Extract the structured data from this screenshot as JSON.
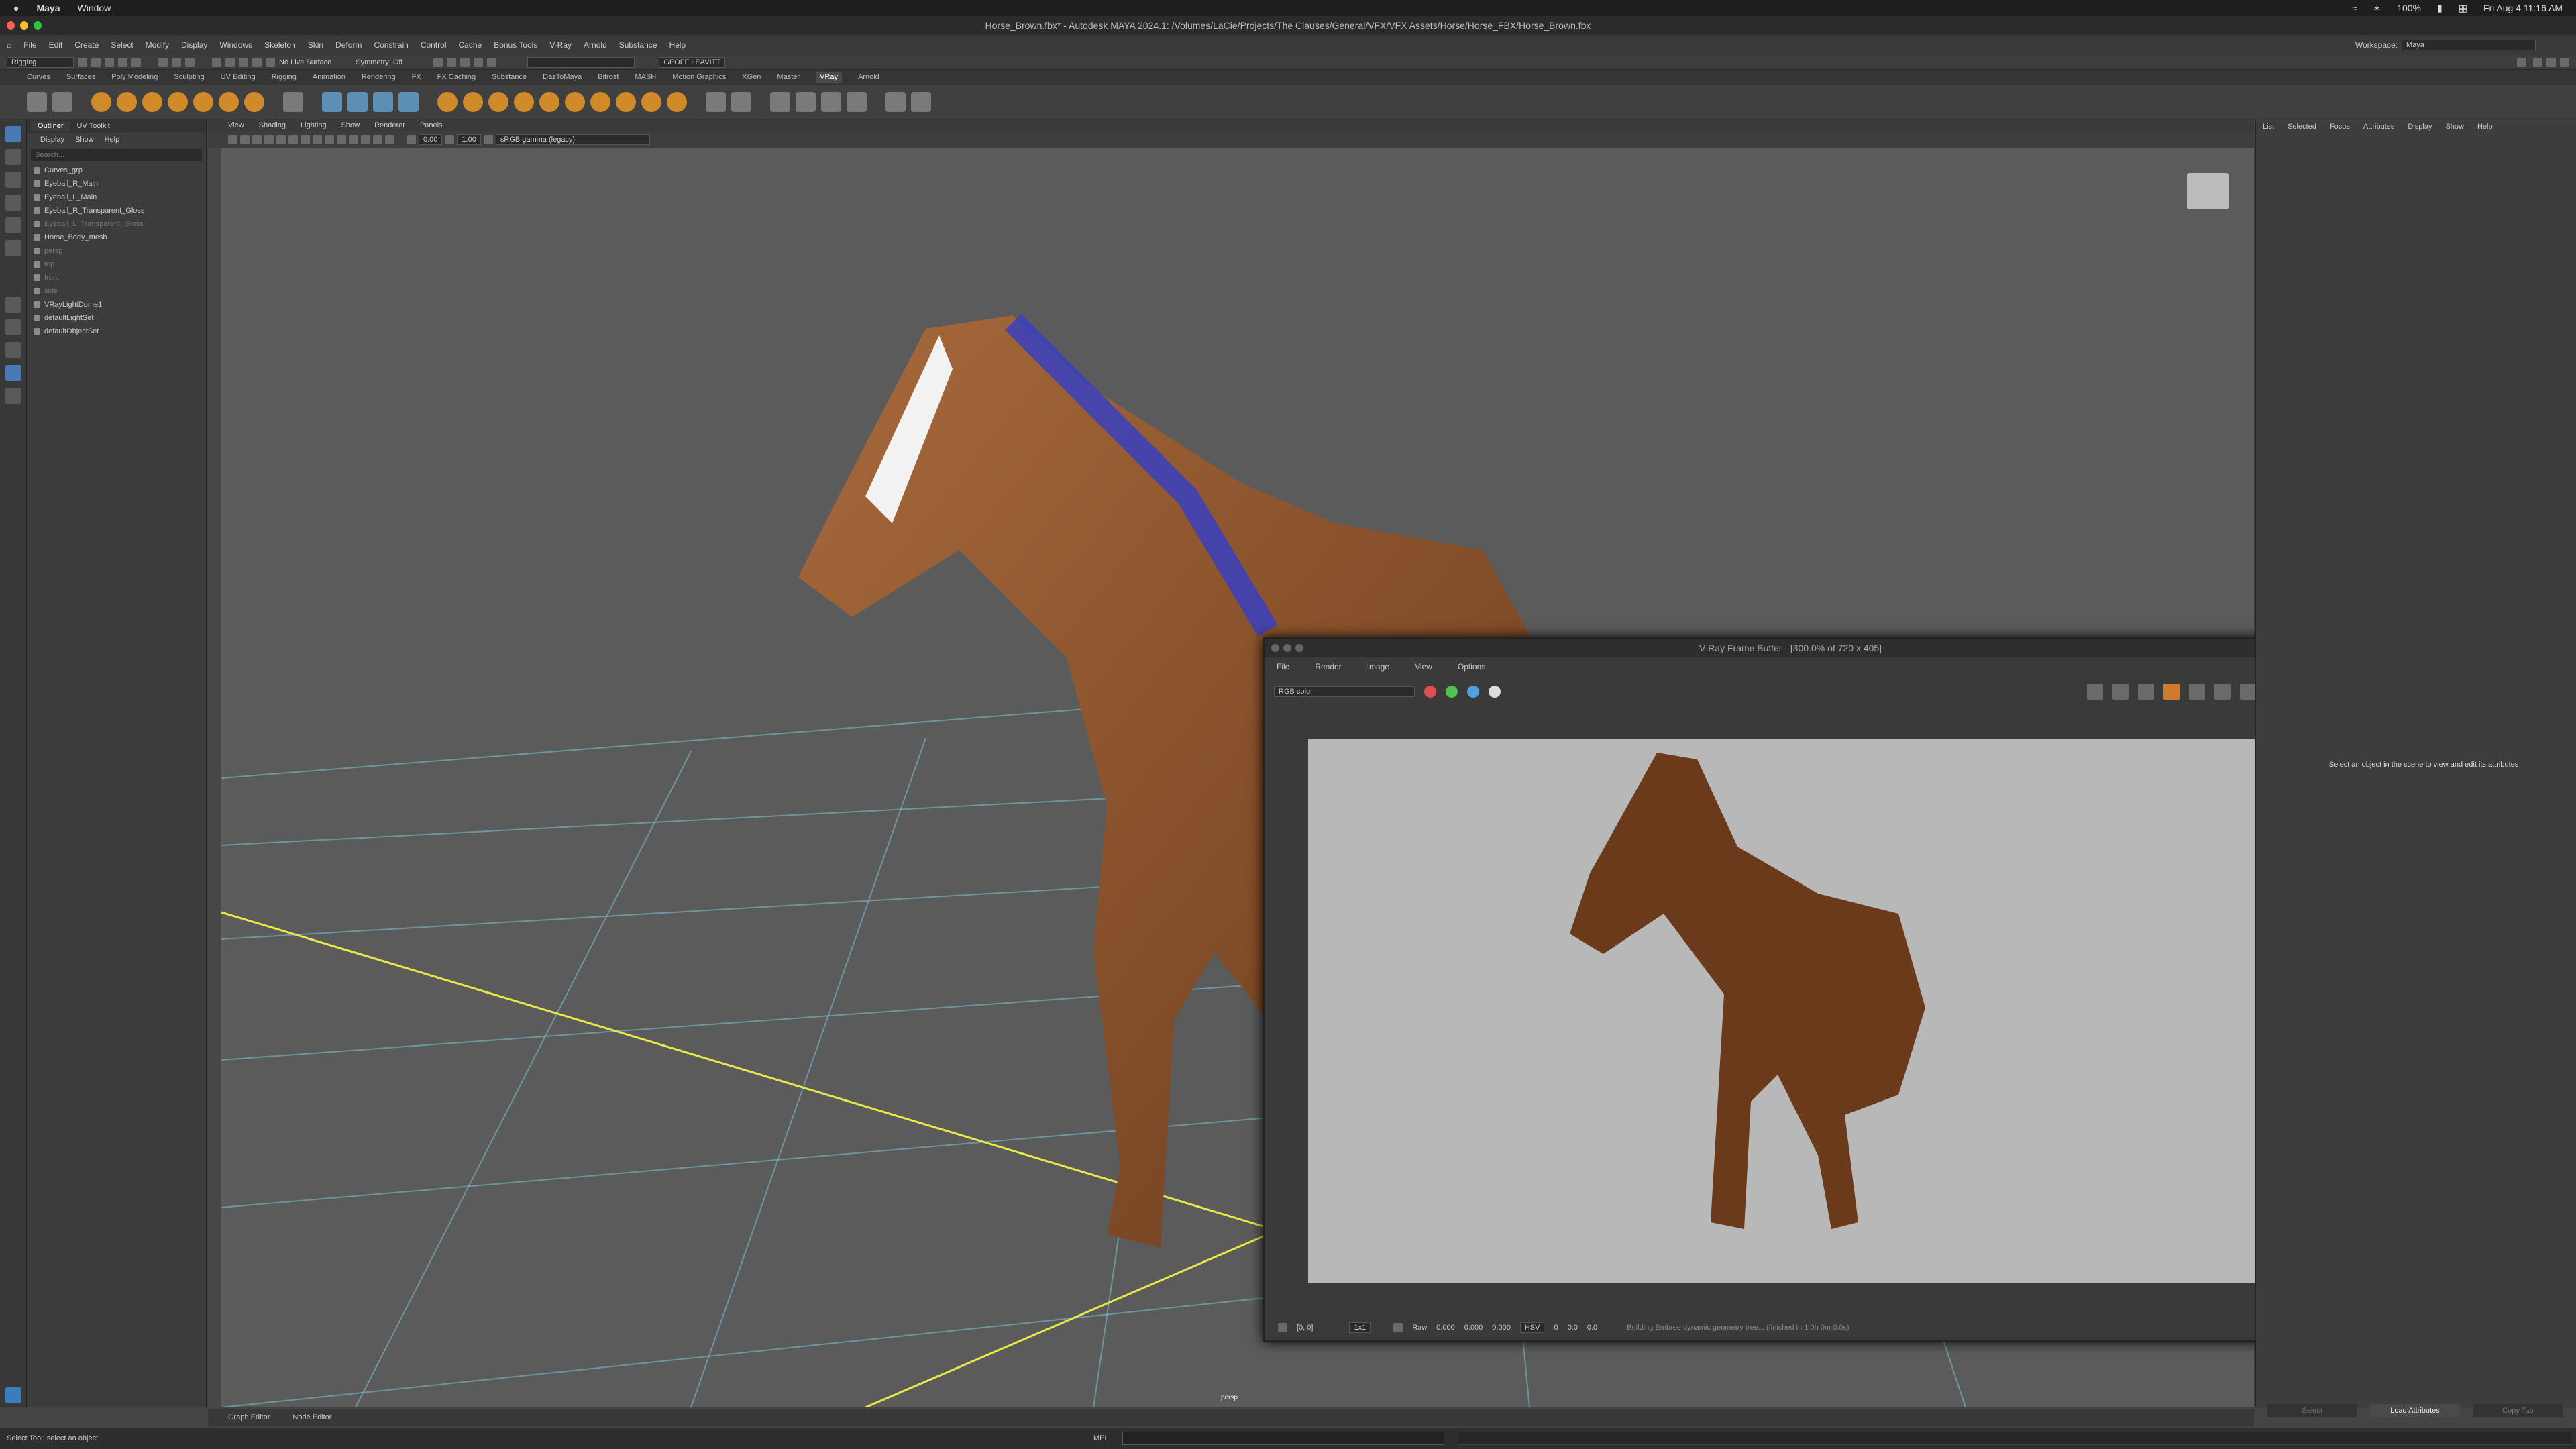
{
  "mac_menu": {
    "apple": "",
    "app": "Maya",
    "window": "Window",
    "battery": "100%",
    "clock": "Fri Aug 4  11:16 AM"
  },
  "title": "Horse_Brown.fbx* - Autodesk MAYA 2024.1: /Volumes/LaCie/Projects/The Clauses/General/VFX/VFX Assets/Horse/Horse_FBX/Horse_Brown.fbx",
  "menus": [
    "File",
    "Edit",
    "Create",
    "Select",
    "Modify",
    "Display",
    "Windows",
    "Skeleton",
    "Skin",
    "Deform",
    "Constrain",
    "Control",
    "Cache",
    "Bonus Tools",
    "V-Ray",
    "Arnold",
    "Substance",
    "Help"
  ],
  "status": {
    "mode": "Rigging",
    "live": "No Live Surface",
    "symmetry": "Symmetry: Off",
    "user": "GEOFF LEAVITT",
    "workspace_label": "Workspace:",
    "workspace": "Maya"
  },
  "shelf_tabs": [
    "Curves",
    "Surfaces",
    "Poly Modeling",
    "Sculpting",
    "UV Editing",
    "Rigging",
    "Animation",
    "Rendering",
    "FX",
    "FX Caching",
    "Substance",
    "DazToMaya",
    "Bifrost",
    "MASH",
    "Motion Graphics",
    "XGen",
    "Master",
    "VRay",
    "Arnold"
  ],
  "shelf_active": "VRay",
  "outliner": {
    "tabs": [
      "Outliner",
      "UV Toolkit"
    ],
    "menu": [
      "Display",
      "Show",
      "Help"
    ],
    "search": "Search...",
    "items": [
      {
        "label": "Curves_grp",
        "dim": false
      },
      {
        "label": "Eyeball_R_Main",
        "dim": false
      },
      {
        "label": "Eyeball_L_Main",
        "dim": false
      },
      {
        "label": "Eyeball_R_Transparent_Gloss",
        "dim": false
      },
      {
        "label": "Eyeball_L_Transparent_Gloss",
        "dim": true
      },
      {
        "label": "Horse_Body_mesh",
        "dim": false
      },
      {
        "label": "persp",
        "dim": true
      },
      {
        "label": "top",
        "dim": true
      },
      {
        "label": "front",
        "dim": true
      },
      {
        "label": "side",
        "dim": true
      },
      {
        "label": "VRayLightDome1",
        "dim": false
      },
      {
        "label": "defaultLightSet",
        "dim": false
      },
      {
        "label": "defaultObjectSet",
        "dim": false
      }
    ]
  },
  "viewport": {
    "menu": [
      "View",
      "Shading",
      "Lighting",
      "Show",
      "Renderer",
      "Panels"
    ],
    "exposure": "0.00",
    "gamma": "1.00",
    "colorspace": "sRGB gamma (legacy)",
    "camera": "persp"
  },
  "vfb": {
    "title": "V-Ray Frame Buffer - [300.0% of 720 x 405]",
    "menu": [
      "File",
      "Render",
      "Image",
      "View",
      "Options"
    ],
    "channel": "RGB color",
    "coords": "[0, 0]",
    "zoom": "1x1",
    "raw": "Raw",
    "r": "0.000",
    "g": "0.000",
    "b": "0.000",
    "mode": "HSV",
    "h": "0",
    "s": "0.0",
    "v": "0.0",
    "message": "Building Embree dynamic geometry tree... (finished in 1.0h  0m  0.0s)"
  },
  "attribute_editor": {
    "menu": [
      "List",
      "Selected",
      "Focus",
      "Attributes",
      "Display",
      "Show",
      "Help"
    ],
    "message": "Select an object in the scene to view and edit its attributes",
    "buttons": [
      "Select",
      "Load Attributes",
      "Copy Tab"
    ]
  },
  "bottom_tabs": [
    "Graph Editor",
    "Node Editor"
  ],
  "cmd": {
    "help": "Select Tool: select an object",
    "lang": "MEL"
  }
}
